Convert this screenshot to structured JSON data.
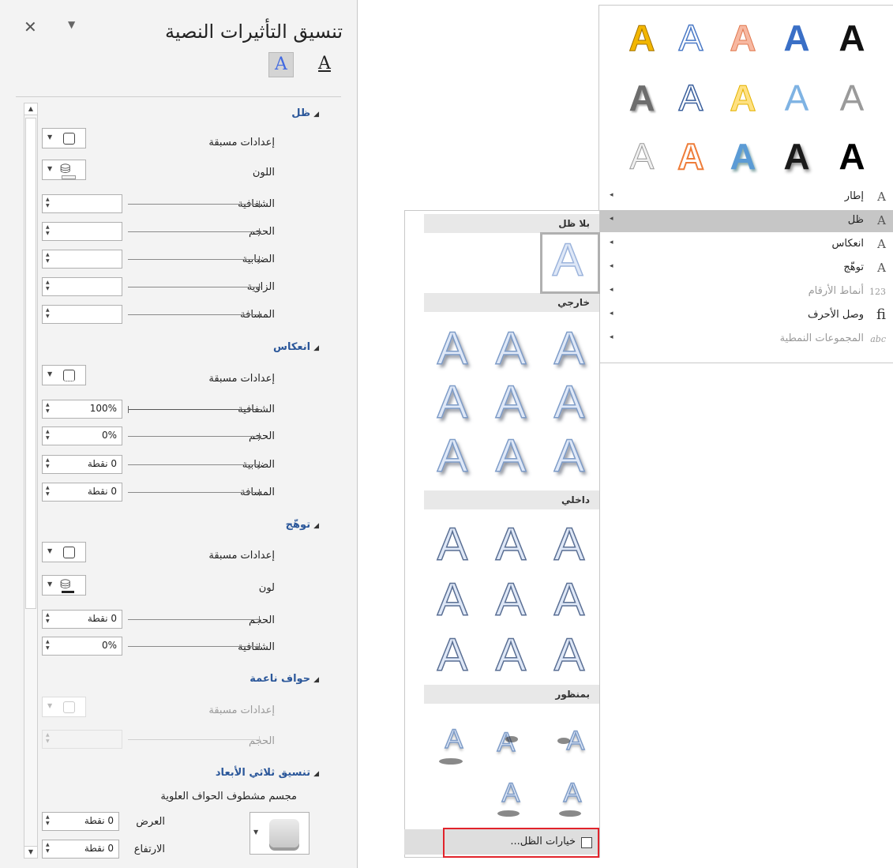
{
  "pane": {
    "title": "تنسيق التأثيرات النصية",
    "close_glyph": "✕",
    "menu_glyph": "▼",
    "tabs": [
      {
        "name": "text-effects-tab",
        "glyph": "A",
        "active": true
      },
      {
        "name": "text-fill-outline-tab",
        "glyph": "A",
        "active": false
      }
    ],
    "shadow": {
      "header": "ظل",
      "presets": "إعدادات مسبقة",
      "color": "اللون",
      "transparency": "الشفافية",
      "size": "الحجم",
      "blur": "الضبابية",
      "angle": "الزاوية",
      "distance": "المسافة"
    },
    "reflection": {
      "header": "انعكاس",
      "presets": "إعدادات مسبقة",
      "transparency": "الشفافية",
      "transparency_value": "100%",
      "size": "الحجم",
      "size_value": "0%",
      "blur": "الضبابية",
      "blur_value": "0 نقطة",
      "distance": "المسافة",
      "distance_value": "0 نقطة"
    },
    "glow": {
      "header": "توهّج",
      "presets": "إعدادات مسبقة",
      "color": "لون",
      "size": "الحجم",
      "size_value": "0 نقطة",
      "transparency": "الشفافية",
      "transparency_value": "0%"
    },
    "soft_edges": {
      "header": "حواف ناعمة",
      "presets": "إعدادات مسبقة",
      "size": "الحجم"
    },
    "format_3d": {
      "header": "تنسيق ثلاثي الأبعاد",
      "top_bevel": "مجسم مشطوف الحواف العلوية",
      "width": "العرض",
      "width_value": "0 نقطة",
      "height": "الارتفاع",
      "height_value": "0 نقطة"
    }
  },
  "gallery": {
    "styles_rows": [
      [
        {
          "color": "#e8a500",
          "style": "gold"
        },
        {
          "color": "#ffffff",
          "style": "outline-blue"
        },
        {
          "color": "#f4a58a",
          "style": "orange-outline"
        },
        {
          "color": "#3a6fc6",
          "style": "blue"
        },
        {
          "color": "#111111",
          "style": "black"
        }
      ],
      [
        {
          "color": "#6d6d6d",
          "style": "gray"
        },
        {
          "color": "#ffffff",
          "style": "outline-blue"
        },
        {
          "color": "#ffd966",
          "style": "yellow"
        },
        {
          "color": "#6fa8dc",
          "style": "reflect-blue"
        },
        {
          "color": "#9a9a9a",
          "style": "gray-light"
        }
      ],
      [
        {
          "color": "#e6e6e6",
          "style": "silver"
        },
        {
          "color": "#f6a06a",
          "style": "orange-outline"
        },
        {
          "color": "#5b9bd5",
          "style": "blue-shadow"
        },
        {
          "color": "#111111",
          "style": "black-shadow"
        },
        {
          "color": "#111111",
          "style": "black-bold"
        }
      ]
    ],
    "menu": [
      {
        "label": "إطار",
        "icon": "A",
        "icon_name": "outline-icon",
        "active": false,
        "dim": false
      },
      {
        "label": "ظل",
        "icon": "A",
        "icon_name": "shadow-icon",
        "active": true,
        "dim": false
      },
      {
        "label": "انعكاس",
        "icon": "A",
        "icon_name": "reflection-icon",
        "active": false,
        "dim": false
      },
      {
        "label": "توهّج",
        "icon": "A",
        "icon_name": "glow-icon",
        "active": false,
        "dim": false
      },
      {
        "label": "أنماط الأرقام",
        "icon": "123",
        "icon_name": "number-styles-icon",
        "active": false,
        "dim": true
      },
      {
        "label": "وصل الأحرف",
        "icon": "fi",
        "icon_name": "ligatures-icon",
        "active": false,
        "dim": false
      },
      {
        "label": "المجموعات النمطية",
        "icon": "abc",
        "icon_name": "stylistic-sets-icon",
        "active": false,
        "dim": true
      }
    ],
    "chevron": "◂"
  },
  "shadow_menu": {
    "no_shadow": "بلا ظل",
    "outer": "خارجي",
    "inner": "داخلي",
    "perspective": "بمنظور",
    "options": "خيارات الظل..."
  },
  "colors": {
    "accent": "#2b579a",
    "highlight_border": "#e1232b"
  }
}
